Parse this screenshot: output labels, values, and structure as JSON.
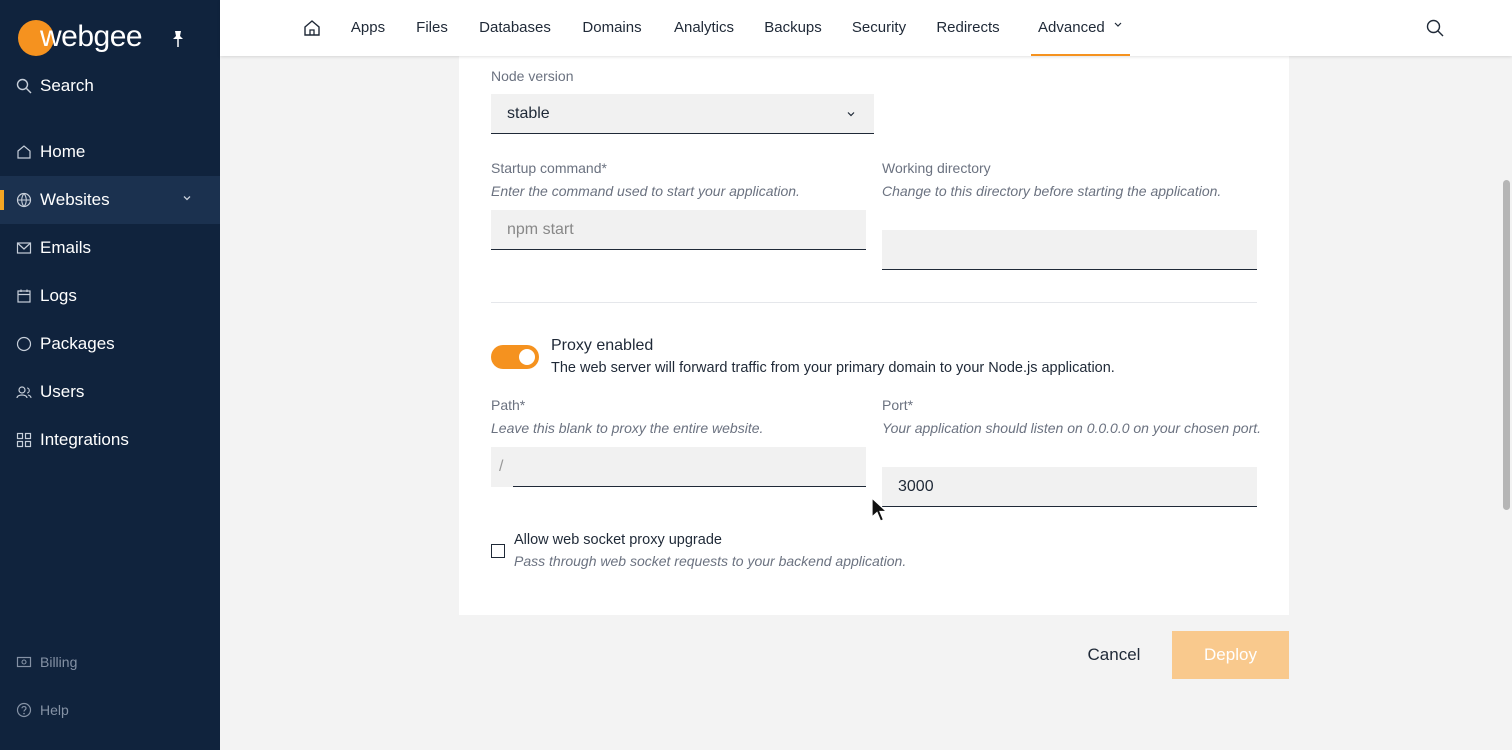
{
  "app": {
    "logo_text": "webgee"
  },
  "sidebar": {
    "search_label": "Search",
    "items": [
      {
        "label": "Home",
        "icon": "home-icon"
      },
      {
        "label": "Websites",
        "icon": "globe-icon"
      },
      {
        "label": "Emails",
        "icon": "mail-icon"
      },
      {
        "label": "Logs",
        "icon": "calendar-icon"
      },
      {
        "label": "Packages",
        "icon": "circle-icon"
      },
      {
        "label": "Users",
        "icon": "users-icon"
      },
      {
        "label": "Integrations",
        "icon": "grid-icon"
      }
    ],
    "footer": [
      {
        "label": "Billing",
        "icon": "billing-icon"
      },
      {
        "label": "Help",
        "icon": "help-icon"
      }
    ]
  },
  "topnav": {
    "tabs": [
      "Apps",
      "Files",
      "Databases",
      "Domains",
      "Analytics",
      "Backups",
      "Security",
      "Redirects",
      "Advanced"
    ],
    "active_tab": "Advanced"
  },
  "form": {
    "node_version": {
      "label": "Node version",
      "value": "stable"
    },
    "startup": {
      "label": "Startup command*",
      "hint": "Enter the command used to start your application.",
      "placeholder": "npm start"
    },
    "workdir": {
      "label": "Working directory",
      "hint": "Change to this directory before starting the application.",
      "value": ""
    },
    "proxy": {
      "title": "Proxy enabled",
      "description": "The web server will forward traffic from your primary domain to your Node.js application.",
      "enabled": true
    },
    "path": {
      "label": "Path*",
      "hint": "Leave this blank to proxy the entire website.",
      "prefix": "/",
      "value": ""
    },
    "port": {
      "label": "Port*",
      "hint": "Your application should listen on 0.0.0.0 on your chosen port.",
      "value": "3000"
    },
    "websocket": {
      "label": "Allow web socket proxy upgrade",
      "hint": "Pass through web socket requests to your backend application.",
      "checked": false
    }
  },
  "actions": {
    "cancel_label": "Cancel",
    "deploy_label": "Deploy"
  },
  "colors": {
    "accent": "#f5921f",
    "sidebar_bg": "#10233d",
    "deploy_disabled": "#f9c98d"
  }
}
